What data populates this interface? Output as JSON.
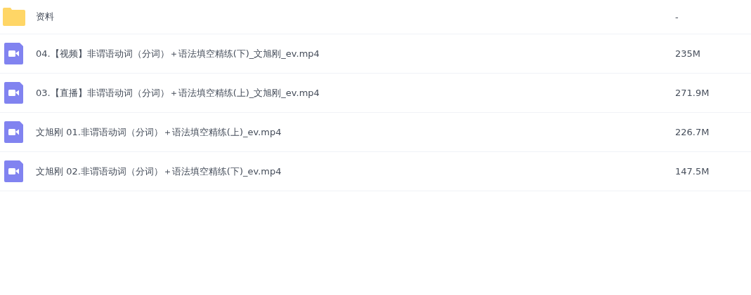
{
  "files": [
    {
      "kind": "folder",
      "name": "资料",
      "size": "-"
    },
    {
      "kind": "video",
      "name": "04.【视频】非谓语动词（分词）＋语法填空精练(下)_文旭刚_ev.mp4",
      "size": "235M"
    },
    {
      "kind": "video",
      "name": "03.【直播】非谓语动词（分词）＋语法填空精练(上)_文旭刚_ev.mp4",
      "size": "271.9M"
    },
    {
      "kind": "video",
      "name": "文旭刚 01.非谓语动词（分词）＋语法填空精练(上)_ev.mp4",
      "size": "226.7M"
    },
    {
      "kind": "video",
      "name": "文旭刚 02.非谓语动词（分词）＋语法填空精练(下)_ev.mp4",
      "size": "147.5M"
    }
  ]
}
